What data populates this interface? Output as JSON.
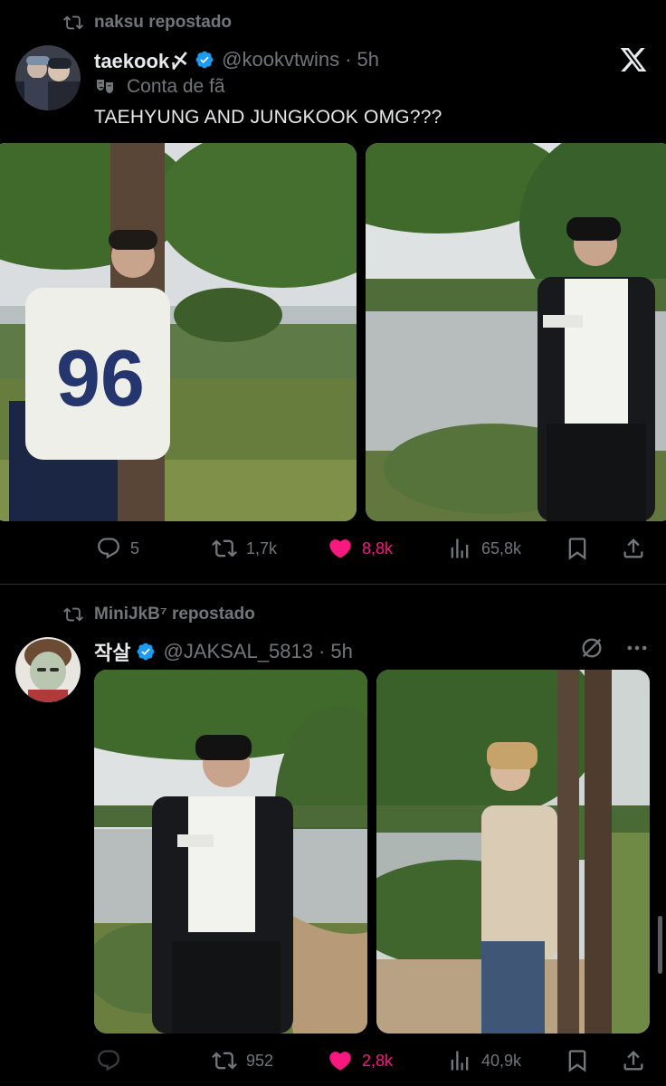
{
  "tweets": [
    {
      "repost_by": "naksu repostado",
      "display_name": "taekook〆",
      "handle": "@kookvtwins",
      "time": "· 5h",
      "label": "Conta de fã",
      "text": "TAEHYUNG AND JUNGKOOK OMG???",
      "stats": {
        "replies": "5",
        "reposts": "1,7k",
        "likes": "8,8k",
        "views": "65,8k"
      }
    },
    {
      "repost_by": "MiniJkB⁷ repostado",
      "display_name": "작살",
      "handle": "@JAKSAL_5813",
      "time": "· 5h",
      "stats": {
        "replies": "",
        "reposts": "952",
        "likes": "2,8k",
        "views": "40,9k"
      }
    }
  ],
  "colors": {
    "background": "#000000",
    "text": "#e7e9ea",
    "muted": "#71767b",
    "like": "#f91880",
    "verified": "#1d9bf0"
  },
  "icons": [
    "repost-icon",
    "verified-badge-icon",
    "fan-account-icon",
    "x-logo-icon",
    "reply-icon",
    "like-icon",
    "views-icon",
    "bookmark-icon",
    "share-icon",
    "grok-icon",
    "more-icon"
  ]
}
